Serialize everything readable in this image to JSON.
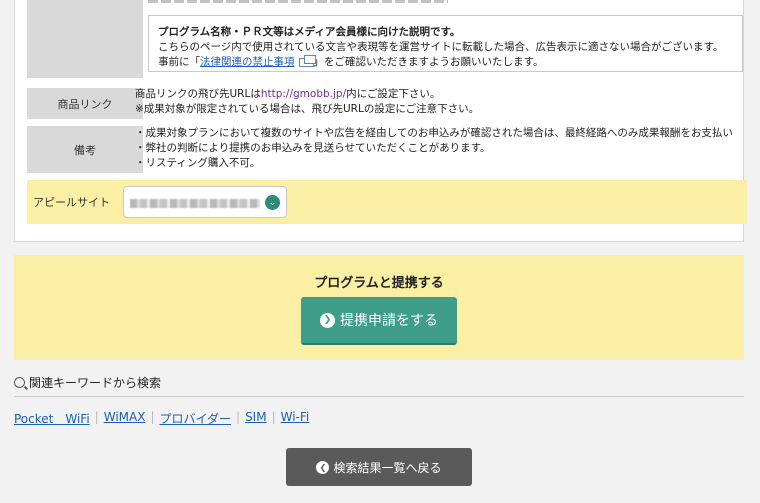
{
  "notice": {
    "line1": "プログラム名称・ＰＲ文等はメディア会員様に向けた説明です。",
    "line2": "こちらのページ内で使用されている文言や表現等を運営サイトに転載した場合、広告表示に適さない場合がございます。",
    "line3_pre": "事前に「",
    "link": "法律関連の禁止事項",
    "line3_post": "」をご確認いただきますようお願いいたします。"
  },
  "product_link": {
    "label": "商品リンク",
    "line1_pre": "商品リンクの飛び先URLは",
    "url": "http://gmobb.jp/",
    "line1_post": "内にご設定下さい。",
    "line2": "※成果対象が限定されている場合は、飛び先URLの設定にご注意下さい。"
  },
  "remarks": {
    "label": "備考",
    "lines": [
      "・成果対象プランにおいて複数のサイトや広告を経由してのお申込みが確認された場合は、最終経路へのみ成果報酬をお支払い",
      "・弊社の判断により提携のお申込みを見送らせていただくことがあります。",
      "・リスティング購入不可。"
    ]
  },
  "appeal": {
    "label": "アピールサイト"
  },
  "cta": {
    "title": "プログラムと提携する",
    "button": "提携申請をする"
  },
  "keywords": {
    "heading": "関連キーワードから検索",
    "items": [
      "Pocket　WiFi",
      "WiMAX",
      "プロバイダー",
      "SIM",
      "Wi-Fi"
    ]
  },
  "back_button": "検索結果一覧へ戻る",
  "colors": {
    "accent_green": "#3f9e8a",
    "highlight_yellow": "#fbeea5",
    "link_blue": "#1a5fb4",
    "url_purple": "#7a2a95"
  }
}
